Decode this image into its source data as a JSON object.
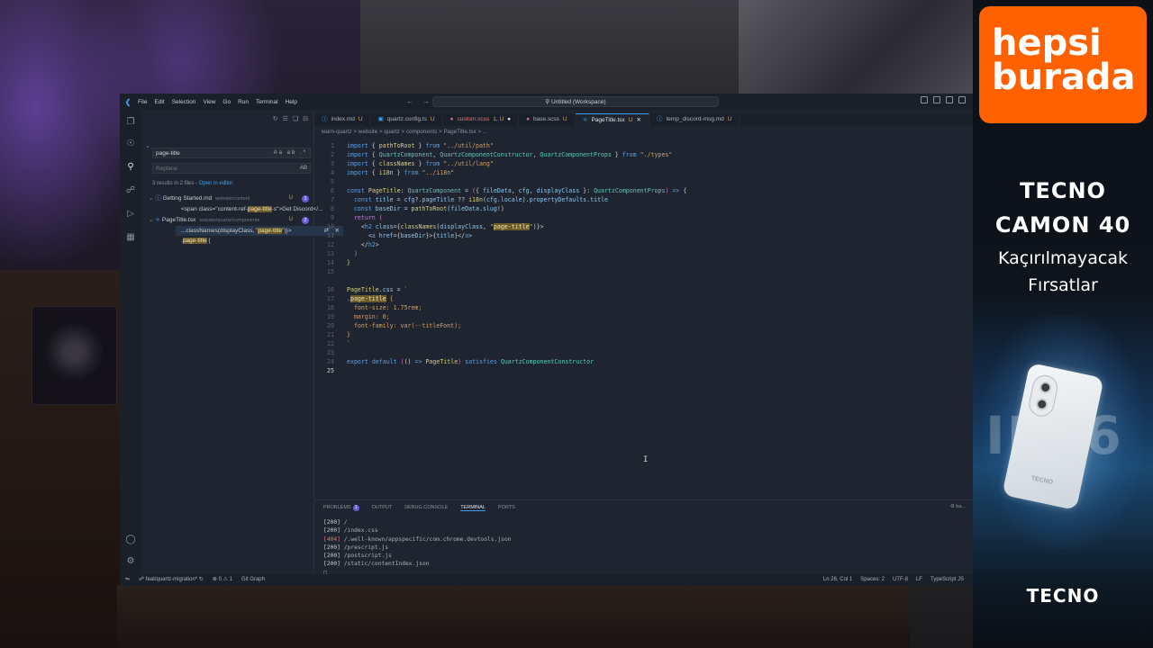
{
  "window": {
    "menu": [
      "File",
      "Edit",
      "Selection",
      "View",
      "Go",
      "Run",
      "Terminal",
      "Help"
    ],
    "command_center": "Untitled (Workspace)"
  },
  "search": {
    "query": "page-title",
    "query_options": "Aa ab .*",
    "replace_placeholder": "Replace",
    "replace_option": "AB",
    "results_text": "3 results in 2 files - ",
    "open_in_editor": "Open in editor",
    "files": [
      {
        "name": "Getting Started.md",
        "path": "website\\content",
        "status": "U",
        "count": "1",
        "matches": [
          {
            "pre": "<span class=\"content-ref-",
            "hit": "page-title",
            "post": "-s\">Get Discord</..."
          }
        ]
      },
      {
        "name": "PageTitle.tsx",
        "path": "website\\quartz\\components",
        "status": "U",
        "count": "2",
        "matches": [
          {
            "pre": "...classNames(displayClass, \"",
            "hit": "page-title",
            "post": "\")}>"
          },
          {
            "pre": ".",
            "hit": "page-title",
            "post": " {"
          }
        ]
      }
    ]
  },
  "tabs": [
    {
      "label": "index.md",
      "status": "U"
    },
    {
      "label": "quartz.config.ts",
      "status": "U"
    },
    {
      "label": "custom.scss",
      "status": "1, U"
    },
    {
      "label": "base.scss",
      "status": "U"
    },
    {
      "label": "PageTitle.tsx",
      "status": "U"
    },
    {
      "label": "temp_discord-msg.md",
      "status": "U"
    }
  ],
  "breadcrumb": "learn-quartz > website > quartz > components > PageTitle.tsx > ...",
  "panel": {
    "tabs": [
      "PROBLEMS",
      "OUTPUT",
      "DEBUG CONSOLE",
      "TERMINAL",
      "PORTS"
    ],
    "problems_count": "1",
    "right_label": "ba..."
  },
  "terminal": [
    {
      "code": "[200]",
      "path": " /"
    },
    {
      "code": "[200]",
      "path": " /index.css"
    },
    {
      "code": "[404]",
      "path": " /.well-known/appspecific/com.chrome.devtools.json"
    },
    {
      "code": "[200]",
      "path": " /prescript.js"
    },
    {
      "code": "[200]",
      "path": " /postscript.js"
    },
    {
      "code": "[200]",
      "path": " /static/contentIndex.json"
    }
  ],
  "status": {
    "branch": "feat/quartz-migration*",
    "errors": "0",
    "warnings": "1",
    "git_graph": "Git Graph",
    "position": "Ln 26, Col 1",
    "spaces": "Spaces: 2",
    "encoding": "UTF-8",
    "eol": "LF",
    "language": "TypeScript JS"
  },
  "ad": {
    "logo_line1": "hepsi",
    "logo_line2": "burada",
    "product_line1": "TECNO",
    "product_line2": "CAMON 40",
    "tagline1": "Kaçırılmayacak",
    "tagline2": "Fırsatlar",
    "rating": "IP66",
    "bottom_brand": "TECNO"
  },
  "colors": {
    "accent": "#3aa0f0",
    "ad_brand": "#ff6000",
    "badge": "#6b5bd6"
  },
  "icons": [
    "explorer-icon",
    "search-icon",
    "source-control-icon",
    "run-debug-icon",
    "extensions-icon",
    "account-icon",
    "settings-icon"
  ]
}
